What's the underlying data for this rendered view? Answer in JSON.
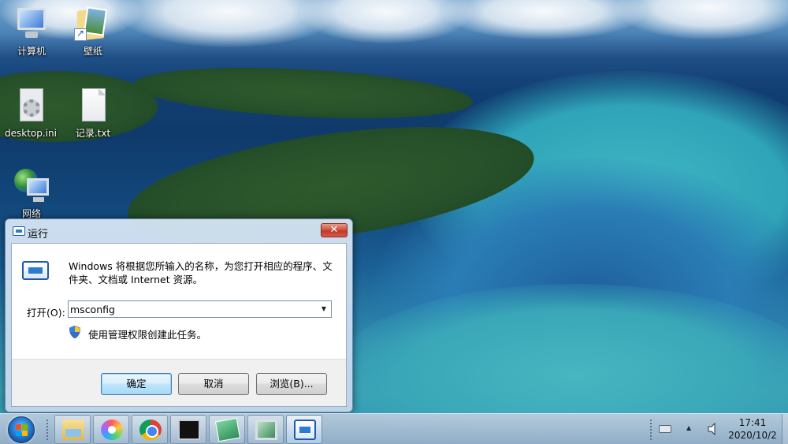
{
  "desktop": {
    "icons": [
      {
        "label": "计算机",
        "icon": "computer-icon"
      },
      {
        "label": "壁纸",
        "icon": "folder-shortcut-icon"
      },
      {
        "label": "desktop.ini",
        "icon": "settings-file-icon"
      },
      {
        "label": "记录.txt",
        "icon": "text-file-icon"
      },
      {
        "label": "网络",
        "icon": "network-icon"
      }
    ]
  },
  "run_dialog": {
    "title": "运行",
    "close_label": "✕",
    "description": "Windows 将根据您所输入的名称，为您打开相应的程序、文件夹、文档或 Internet 资源。",
    "open_label": "打开(O):",
    "open_value": "msconfig",
    "admin_note": "使用管理权限创建此任务。",
    "buttons": {
      "ok": "确定",
      "cancel": "取消",
      "browse": "浏览(B)..."
    }
  },
  "taskbar": {
    "apps": [
      {
        "name": "explorer",
        "icon": "folder-icon"
      },
      {
        "name": "petal",
        "icon": "pinwheel-icon"
      },
      {
        "name": "chrome",
        "icon": "chrome-icon"
      },
      {
        "name": "cmd",
        "icon": "terminal-icon"
      },
      {
        "name": "notes",
        "icon": "notes-icon"
      },
      {
        "name": "monitor",
        "icon": "monitor-icon"
      },
      {
        "name": "run",
        "icon": "run-icon",
        "active": true
      }
    ],
    "clock": {
      "time": "17:41",
      "date": "2020/10/2"
    }
  },
  "colors": {
    "taskbar": "#aebfd2",
    "dialog_frame": "#c4d7ec",
    "close_button": "#c0392b",
    "default_button": "#bee6fd"
  }
}
